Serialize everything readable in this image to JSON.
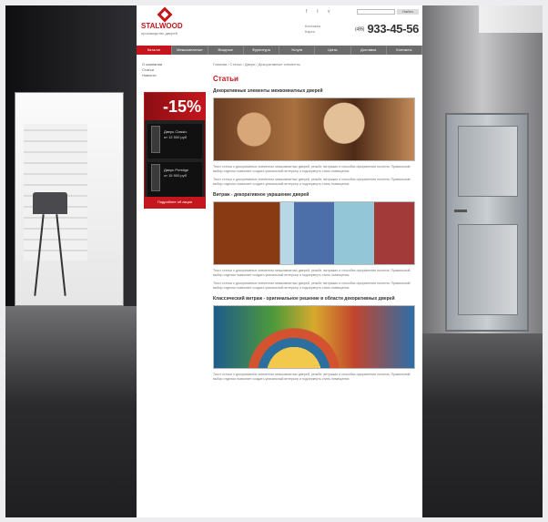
{
  "header": {
    "logo_text": "STALWOOD",
    "logo_sub": "производство дверей",
    "social": [
      "f",
      "t",
      "v"
    ],
    "search_button": "Найти",
    "phone_prefix": "(495)",
    "phone_number": "933-45-56",
    "contacts": "Контакты\nКарта"
  },
  "nav": [
    "Каталог",
    "Межкомнатные",
    "Входные",
    "Фурнитура",
    "Услуги",
    "Цены",
    "Доставка",
    "Контакты"
  ],
  "sidebar": {
    "crumbs": "О компании\nСтатьи\nНовости",
    "promo_discount": "-15%",
    "promo_items": [
      "Дверь Classic\nот 12 500 руб",
      "Дверь Prestige\nот 15 900 руб"
    ],
    "promo_bottom": "Подробнее об акции"
  },
  "main": {
    "breadcrumb": "Главная  /  Статьи  /  Двери  /  Декоративные элементы",
    "title": "Статьи",
    "sections": [
      {
        "heading": "Декоративные элементы межкомнатных дверей"
      },
      {
        "heading": "Витраж - декоративное украшение дверей"
      },
      {
        "heading": "Классический витраж - оригинальное решение в области декоративных дверей"
      }
    ],
    "paragraph": "Текст статьи о декоративных элементах межкомнатных дверей, резьбе, витражах и способах оформления полотна. Правильный выбор отделки позволяет создать уникальный интерьер и подчеркнуть стиль помещения."
  }
}
